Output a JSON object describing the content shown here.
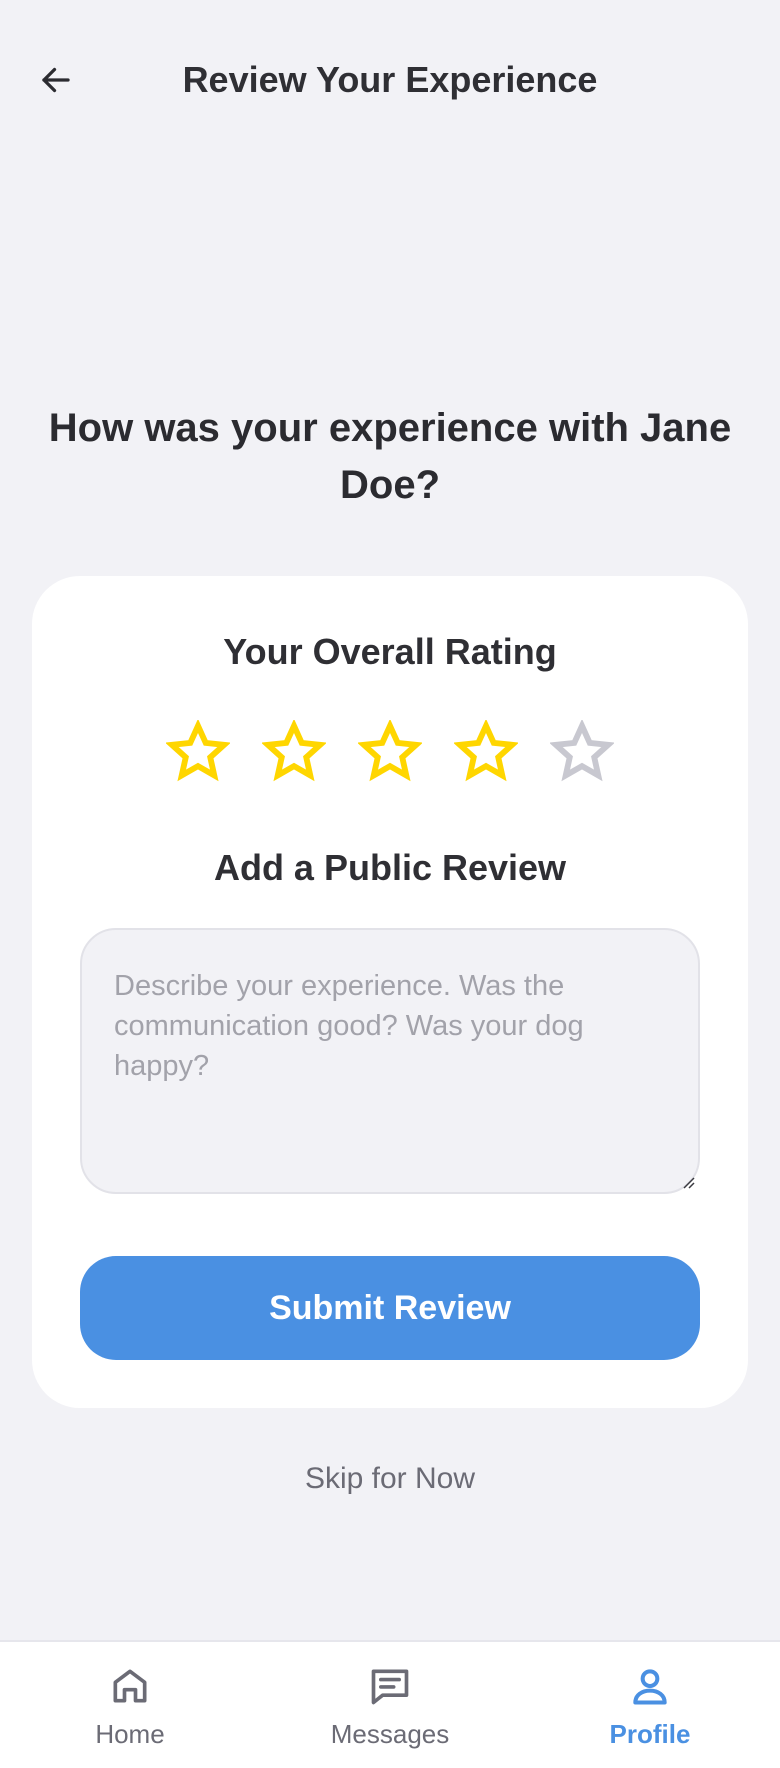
{
  "header": {
    "title": "Review Your Experience",
    "back_icon": "arrow-left-icon"
  },
  "question": "How was your experience with Jane Doe?",
  "card": {
    "rating_title": "Your Overall Rating",
    "rating": {
      "value": 4,
      "max": 5
    },
    "review_title": "Add a Public Review",
    "review_value": "",
    "review_placeholder": "Describe your experience. Was the communication good? Was your dog happy?",
    "submit_label": "Submit Review"
  },
  "skip_label": "Skip for Now",
  "nav": {
    "items": [
      {
        "label": "Home",
        "icon": "home-icon",
        "active": false
      },
      {
        "label": "Messages",
        "icon": "messages-icon",
        "active": false
      },
      {
        "label": "Profile",
        "icon": "profile-icon",
        "active": true
      }
    ]
  },
  "colors": {
    "accent": "#4a90e2",
    "star_filled": "#ffd600",
    "star_empty": "#c8c8d0",
    "background": "#f2f2f6",
    "card": "#ffffff"
  }
}
